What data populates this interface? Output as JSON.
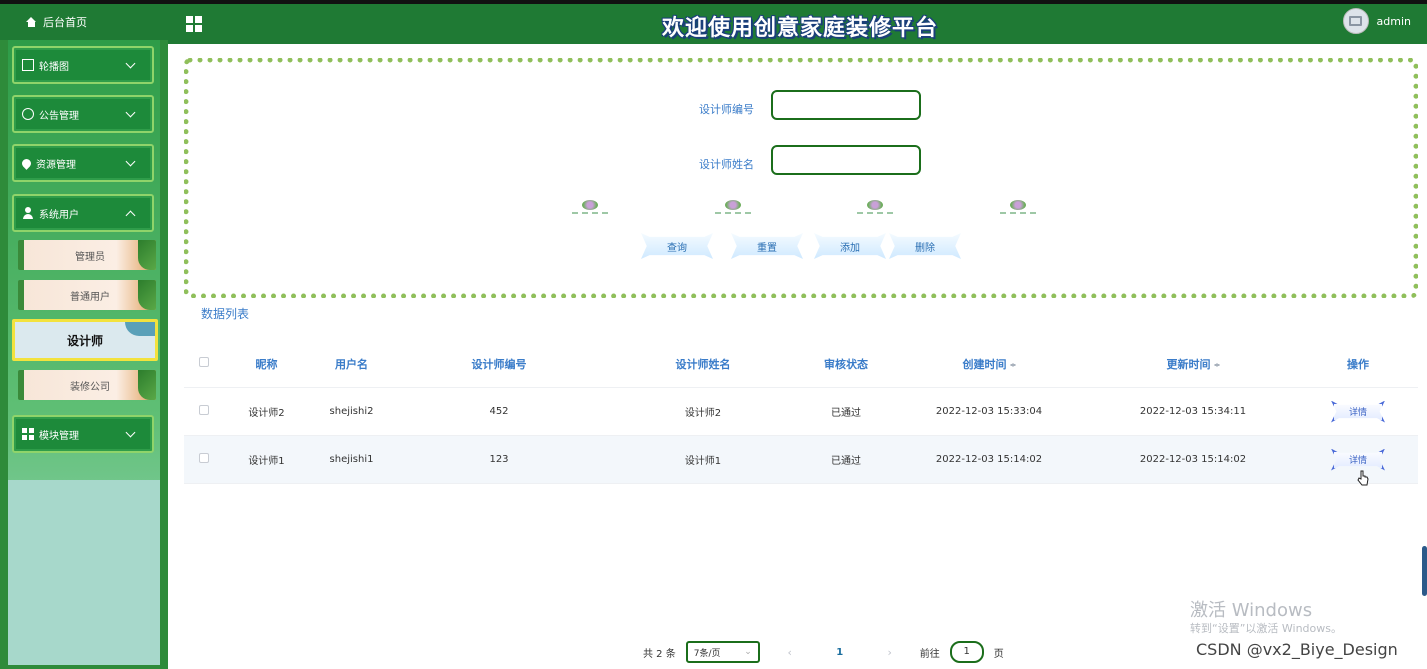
{
  "header": {
    "home_label": "后台首页",
    "title": "欢迎使用创意家庭装修平台",
    "username": "admin"
  },
  "sidebar": {
    "menus": [
      {
        "label": "轮播图",
        "icon": "image-icon"
      },
      {
        "label": "公告管理",
        "icon": "info-icon"
      },
      {
        "label": "资源管理",
        "icon": "location-icon"
      },
      {
        "label": "系统用户",
        "icon": "user-icon",
        "expanded": true
      },
      {
        "label": "模块管理",
        "icon": "grid-icon"
      }
    ],
    "sub_items": [
      "管理员",
      "普通用户",
      "设计师",
      "装修公司"
    ],
    "active_sub": "设计师"
  },
  "search": {
    "field1_label": "设计师编号",
    "field1_value": "",
    "field2_label": "设计师姓名",
    "field2_value": "",
    "buttons": {
      "query": "查询",
      "reset": "重置",
      "add": "添加",
      "delete": "删除"
    }
  },
  "list": {
    "title": "数据列表",
    "columns": [
      "昵称",
      "用户名",
      "设计师编号",
      "设计师姓名",
      "审核状态",
      "创建时间",
      "更新时间",
      "操作"
    ],
    "rows": [
      {
        "nickname": "设计师2",
        "username": "shejishi2",
        "designer_no": "452",
        "designer_name": "设计师2",
        "status": "已通过",
        "created": "2022-12-03 15:33:04",
        "updated": "2022-12-03 15:34:11",
        "action": "详情"
      },
      {
        "nickname": "设计师1",
        "username": "shejishi1",
        "designer_no": "123",
        "designer_name": "设计师1",
        "status": "已通过",
        "created": "2022-12-03 15:14:02",
        "updated": "2022-12-03 15:14:02",
        "action": "详情"
      }
    ]
  },
  "pagination": {
    "total": "共 2 条",
    "page_size": "7条/页",
    "prev": "‹",
    "current": "1",
    "next": "›",
    "goto_prefix": "前往",
    "goto_value": "1",
    "goto_suffix": "页"
  },
  "overlay": {
    "activate_title": "激活 Windows",
    "activate_sub": "转到“设置”以激活 Windows。",
    "credit": "CSDN @vx2_Biye_Design"
  }
}
